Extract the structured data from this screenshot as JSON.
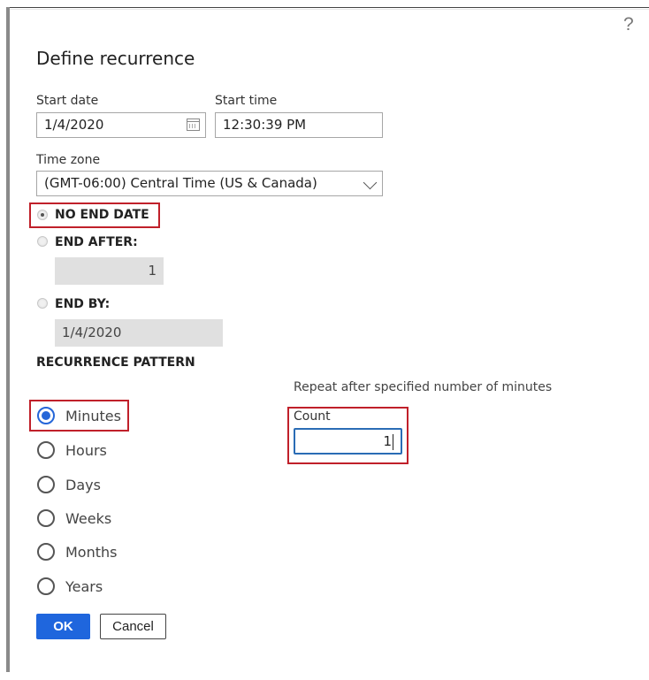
{
  "dialog": {
    "title": "Define recurrence",
    "help_icon": "?"
  },
  "start": {
    "date_label": "Start date",
    "date_value": "1/4/2020",
    "time_label": "Start time",
    "time_value": "12:30:39 PM"
  },
  "timezone": {
    "label": "Time zone",
    "selected": "(GMT-06:00) Central Time (US & Canada)"
  },
  "end_options": {
    "selected": "no_end_date",
    "no_end_date_label": "NO END DATE",
    "end_after_label": "END AFTER:",
    "end_after_value": "1",
    "end_by_label": "END BY:",
    "end_by_value": "1/4/2020"
  },
  "pattern": {
    "heading": "RECURRENCE PATTERN",
    "selected": "Minutes",
    "options": [
      "Minutes",
      "Hours",
      "Days",
      "Weeks",
      "Months",
      "Years"
    ],
    "hint": "Repeat after specified number of minutes",
    "count_label": "Count",
    "count_value": "1"
  },
  "buttons": {
    "ok": "OK",
    "cancel": "Cancel"
  },
  "colors": {
    "accent": "#1f66dd",
    "highlight_box": "#c0202a"
  }
}
